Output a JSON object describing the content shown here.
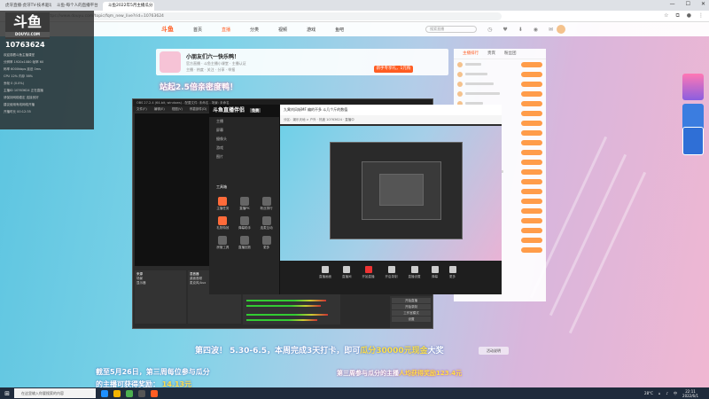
{
  "browser": {
    "tabs": [
      {
        "label": "虎牙直播-虎牙TV-技术驱动娱乐",
        "active": false
      },
      {
        "label": "斗鱼-每个人的直播平台",
        "active": false
      },
      {
        "label": "斗鱼2022年5月主播瓜分",
        "active": true
      }
    ],
    "url": "https://www.douyu.com/topic/fqm_new_live?rid=10763624",
    "nav": {
      "back": "←",
      "forward": "→",
      "refresh": "⟳"
    },
    "window_controls": {
      "min": "—",
      "max": "☐",
      "close": "✕"
    }
  },
  "site": {
    "logo": "斗鱼",
    "nav": [
      "首页",
      "直播",
      "分类",
      "视频",
      "游戏",
      "鱼吧"
    ],
    "nav_active": 1,
    "search_placeholder": "搜索直播",
    "header_icons": [
      "历史",
      "关注",
      "下载",
      "开播",
      "消息"
    ]
  },
  "room": {
    "title": "小朋友们六一快乐鸭！",
    "meta": "官方直播 · 斗鱼主播小课堂 · 主播认证",
    "stats": "主播 · 热度 · 关注 · 分享 · 举报",
    "gift_button": "新手专享礼，1元购",
    "banner": "站起2.5倍亲密度鸭！"
  },
  "chat": {
    "tabs": [
      "主播排行",
      "贵宾",
      "粉丝团"
    ],
    "active_tab": 0,
    "line_count": 20
  },
  "overlay": {
    "logo": "斗鱼",
    "logo_sub": "DOUYU.COM",
    "room_id": "10763624",
    "lines": [
      "欢迎观看斗鱼主播课堂",
      "分辨率 1920x1080  帧率 60",
      "码率 6000kbps  延迟 0ms",
      "CPU 12%  内存 38%",
      "丢帧 0 (0.0%)",
      "主播ID 10763624 正在直播",
      "请保持网络稳定 连接良好",
      "建议使用有线网络开播",
      "开播时长 00:12:35"
    ]
  },
  "obs": {
    "title": "OBS 27.2.4 (64-bit, windows) - 配置文件: 未命名 - 场景: 未命名",
    "menu": [
      "文件(F)",
      "编辑(E)",
      "视图(V)",
      "停靠部件(D)",
      "配置文件(P)",
      "场景集合(S)",
      "工具(T)",
      "帮助(H)"
    ],
    "scenes_title": "来源",
    "scenes": [
      "场景",
      "显示器"
    ],
    "sources_title": "混音器",
    "sources": [
      "桌面音频",
      "麦克风/Aux"
    ],
    "controls": [
      "开始直播",
      "开始录制",
      "工作室模式",
      "设置",
      "退出"
    ]
  },
  "assistant": {
    "brand": "斗鱼直播伴侣",
    "badge": "免费",
    "rows": [
      "主播",
      "屏幕",
      "摄像头",
      "游戏",
      "图片"
    ],
    "tools_title": "工具箱",
    "tools": [
      {
        "label": "主播任务",
        "accent": true
      },
      {
        "label": "直播PK",
        "accent": false
      },
      {
        "label": "粉丝排行",
        "accent": false
      },
      {
        "label": "礼物特效",
        "accent": true
      },
      {
        "label": "弹幕助手",
        "accent": false
      },
      {
        "label": "连麦互动",
        "accent": false
      },
      {
        "label": "房管工具",
        "accent": false
      },
      {
        "label": "直播回放",
        "accent": false
      },
      {
        "label": "更多",
        "accent": false
      }
    ]
  },
  "inner_view": {
    "title": "九霄刘风斩MF 编的不多 斗几个斤的数值",
    "subtitle": "分区：娱乐天地 > 户外 · 热度 10763624 · 直播中",
    "buttons": [
      {
        "label": "直播画面",
        "red": false
      },
      {
        "label": "直播间",
        "red": false
      },
      {
        "label": "开始直播",
        "red": true
      },
      {
        "label": "开启录制",
        "red": false
      },
      {
        "label": "直播设置",
        "red": false
      },
      {
        "label": "弹幕",
        "red": false
      },
      {
        "label": "更多",
        "red": false
      }
    ]
  },
  "promo": {
    "line1_prefix": "第四波！ 5.30-6.5，本周完成3天打卡，即可",
    "line1_highlight": "瓜分30000元现金",
    "line1_suffix": "大奖",
    "line2a": "截至5月26日，第三周每位参与瓜分",
    "line2b_prefix": "的主播可获得奖励：",
    "line2b_highlight": "14.13元",
    "line3_prefix": "第三周参与瓜分的主播",
    "line3_highlight": "人均获得奖励123.4元",
    "rules_button": "活动说明"
  },
  "taskbar": {
    "start": "⊞",
    "search_placeholder": "在这里输入你要搜索的内容",
    "tray_temp": "28°C",
    "tray_lang": "中",
    "time": "22:11",
    "date": "2022/6/1"
  },
  "colors": {
    "brand": "#ff5d23",
    "highlight": "#ffe04a"
  }
}
